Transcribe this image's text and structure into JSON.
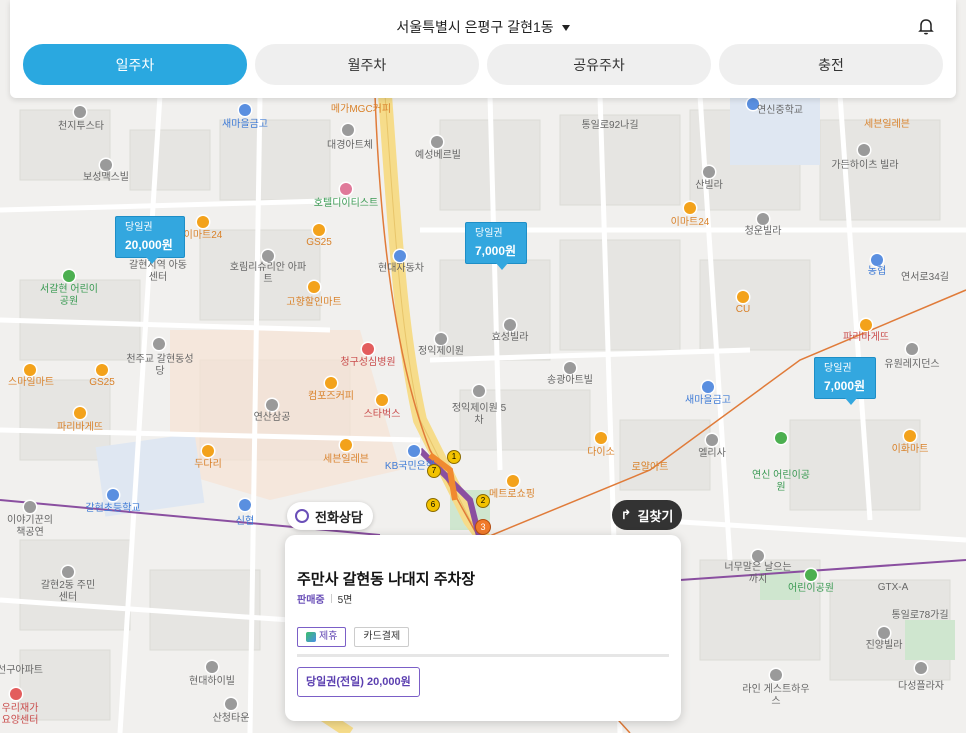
{
  "header": {
    "location": "서울특별시 은평구 갈현1동",
    "tabs": [
      {
        "label": "일주차",
        "active": true
      },
      {
        "label": "월주차",
        "active": false
      },
      {
        "label": "공유주차",
        "active": false
      },
      {
        "label": "충전",
        "active": false
      }
    ],
    "icons": {
      "bell": "bell-icon",
      "caret": "chevron-down-icon"
    }
  },
  "price_tags": [
    {
      "kind": "당일권",
      "amount": "20,000원"
    },
    {
      "kind": "당일권",
      "amount": "7,000원"
    },
    {
      "kind": "당일권",
      "amount": "7,000원"
    }
  ],
  "map_labels": [
    "천지투스타",
    "보성맥스빌",
    "새마을금고",
    "대경아트체",
    "메가MGC커피",
    "예성베르빌",
    "통일로92나길",
    "연신중학교",
    "세븐일레븐",
    "가든하이츠 빌라",
    "산빌라",
    "이마트24",
    "청운빌라",
    "농협",
    "연서로34길",
    "CU",
    "GS25",
    "호텔디이티스트",
    "호림리슈리안 아파트",
    "현대자동차",
    "고향할인마트",
    "이마트24",
    "갈현지역 아동센터",
    "서갈현 어린이공원",
    "천주교 갈현동성당",
    "스마일마트",
    "GS25",
    "파리바게뜨",
    "정익제이원",
    "효성빌라",
    "청구성심병원",
    "송광아트빌",
    "컴포즈커피",
    "스타벅스",
    "연산삼공",
    "새마을금고",
    "정익제이원 5차",
    "세븐일레븐",
    "KB국민은행",
    "메트로쇼핑",
    "다이소",
    "로얄아트",
    "엘리사",
    "연신 어린이공원",
    "이화마트",
    "두다리",
    "갈현초등학교",
    "신협",
    "이야기꾼의 책공연",
    "갈현2동 주민센터",
    "선구아파트",
    "현대하이빌",
    "산청타운",
    "우리재가 요양센터",
    "너무말은 날으는까치",
    "어린이공원",
    "진양빌라",
    "라인 게스트하우스",
    "다성플라자",
    "파리바게뜨",
    "유원레지던스",
    "GTX-A",
    "통일로78가길"
  ],
  "station_numbers": [
    "1",
    "2",
    "3",
    "6",
    "7"
  ],
  "buttons": {
    "phone": "전화상담",
    "directions": "길찾기"
  },
  "info_card": {
    "title": "주만사 갈현동 나대지 주차장",
    "status": "판매중",
    "spaces": "5면",
    "badges": [
      "제휴",
      "카드결제"
    ],
    "ticket": "당일권(전일) 20,000원"
  },
  "colors": {
    "accent": "#2aa8e0",
    "partner": "#6a4fb8",
    "road_main": "#f6dc8a",
    "road_metro": "#8a4fa0",
    "road_rail": "#e07b39"
  }
}
